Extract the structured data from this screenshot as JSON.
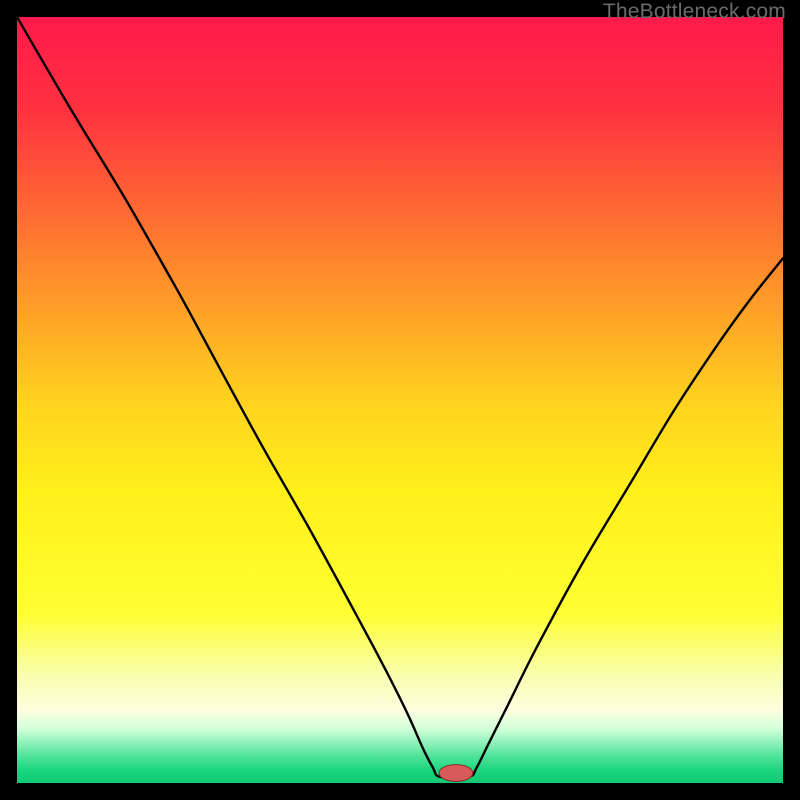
{
  "watermark": "TheBottleneck.com",
  "chart_data": {
    "type": "line",
    "title": "",
    "xlabel": "",
    "ylabel": "",
    "xlim": [
      0,
      100
    ],
    "ylim": [
      0,
      100
    ],
    "background_gradient": {
      "stops": [
        {
          "offset": 0.0,
          "color": "#ff1a4b"
        },
        {
          "offset": 0.12,
          "color": "#ff3140"
        },
        {
          "offset": 0.3,
          "color": "#ff7d2e"
        },
        {
          "offset": 0.5,
          "color": "#ffd21f"
        },
        {
          "offset": 0.62,
          "color": "#fff01a"
        },
        {
          "offset": 0.78,
          "color": "#ffff33"
        },
        {
          "offset": 0.86,
          "color": "#f8ffb0"
        },
        {
          "offset": 0.905,
          "color": "#fdffe0"
        },
        {
          "offset": 0.93,
          "color": "#cfffd8"
        },
        {
          "offset": 0.965,
          "color": "#4fe39a"
        },
        {
          "offset": 0.985,
          "color": "#18d47c"
        },
        {
          "offset": 1.0,
          "color": "#12c973"
        }
      ]
    },
    "series": [
      {
        "name": "bottleneck-curve",
        "color": "#000000",
        "width": 2.4,
        "points": [
          {
            "x": 0.0,
            "y": 100.0
          },
          {
            "x": 7.0,
            "y": 88.0
          },
          {
            "x": 14.0,
            "y": 76.5
          },
          {
            "x": 20.0,
            "y": 66.0
          },
          {
            "x": 22.5,
            "y": 61.5
          },
          {
            "x": 26.0,
            "y": 55.0
          },
          {
            "x": 32.0,
            "y": 44.0
          },
          {
            "x": 38.0,
            "y": 33.5
          },
          {
            "x": 44.0,
            "y": 22.5
          },
          {
            "x": 48.0,
            "y": 15.0
          },
          {
            "x": 51.0,
            "y": 9.0
          },
          {
            "x": 53.0,
            "y": 4.5
          },
          {
            "x": 54.3,
            "y": 2.0
          },
          {
            "x": 55.2,
            "y": 0.8
          },
          {
            "x": 59.0,
            "y": 0.8
          },
          {
            "x": 60.0,
            "y": 2.0
          },
          {
            "x": 61.5,
            "y": 5.0
          },
          {
            "x": 64.0,
            "y": 10.0
          },
          {
            "x": 68.0,
            "y": 18.0
          },
          {
            "x": 74.0,
            "y": 29.0
          },
          {
            "x": 80.0,
            "y": 39.0
          },
          {
            "x": 86.0,
            "y": 49.0
          },
          {
            "x": 92.0,
            "y": 58.0
          },
          {
            "x": 96.0,
            "y": 63.5
          },
          {
            "x": 100.0,
            "y": 68.5
          }
        ]
      }
    ],
    "marker": {
      "name": "optimal-point",
      "cx": 57.3,
      "cy": 1.3,
      "rx": 2.2,
      "ry": 1.1,
      "fill": "#d85a5a",
      "stroke": "#8a2c2c"
    }
  }
}
